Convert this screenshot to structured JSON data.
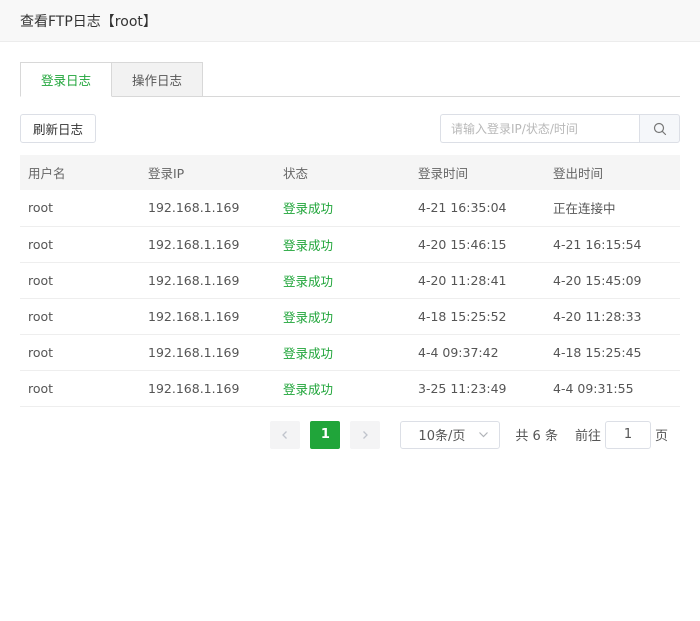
{
  "dialog": {
    "title": "查看FTP日志【root】"
  },
  "tabs": [
    {
      "label": "登录日志",
      "active": true
    },
    {
      "label": "操作日志",
      "active": false
    }
  ],
  "toolbar": {
    "refresh_label": "刷新日志",
    "search_placeholder": "请输入登录IP/状态/时间",
    "search_icon": "search-icon"
  },
  "table": {
    "columns": [
      "用户名",
      "登录IP",
      "状态",
      "登录时间",
      "登出时间"
    ],
    "rows": [
      [
        "root",
        "192.168.1.169",
        "登录成功",
        "4-21 16:35:04",
        "正在连接中"
      ],
      [
        "root",
        "192.168.1.169",
        "登录成功",
        "4-20 15:46:15",
        "4-21 16:15:54"
      ],
      [
        "root",
        "192.168.1.169",
        "登录成功",
        "4-20 11:28:41",
        "4-20 15:45:09"
      ],
      [
        "root",
        "192.168.1.169",
        "登录成功",
        "4-18 15:25:52",
        "4-20 11:28:33"
      ],
      [
        "root",
        "192.168.1.169",
        "登录成功",
        "4-4 09:37:42",
        "4-18 15:25:45"
      ],
      [
        "root",
        "192.168.1.169",
        "登录成功",
        "3-25 11:23:49",
        "4-4 09:31:55"
      ]
    ]
  },
  "pagination": {
    "current_page": "1",
    "page_size": "10条/页",
    "total": "共 6 条",
    "goto_prefix": "前往",
    "goto_value": "1",
    "goto_suffix": "页"
  },
  "colors": {
    "accent": "#20a53a"
  }
}
